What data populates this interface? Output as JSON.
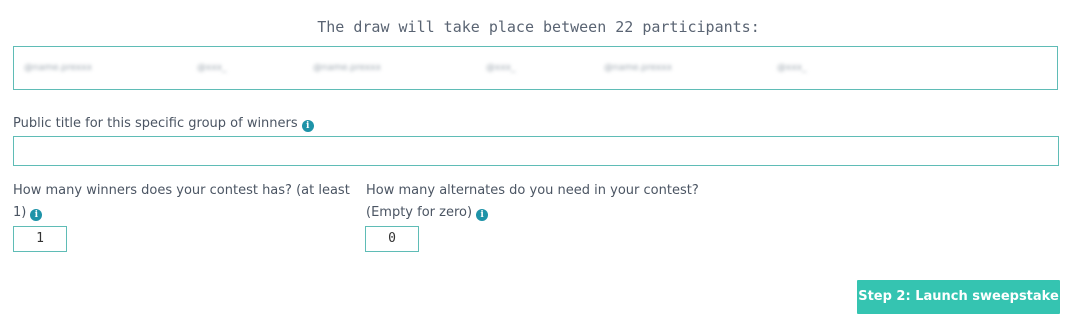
{
  "header": {
    "title": "The draw will take place between 22 participants:"
  },
  "participants": {
    "items": [
      "@name.prexxx",
      "@xxx_",
      "@name.prexxx",
      "@xxx_",
      "@name.prexxx",
      "@xxx_"
    ]
  },
  "form": {
    "public_title": {
      "label": "Public title for this specific group of winners",
      "value": ""
    },
    "winners": {
      "label_line1": "How many winners does your contest has? (at least",
      "label_line2": "1)",
      "value": "1"
    },
    "alternates": {
      "label_line1": "How many alternates do you need in your contest?",
      "label_line2": "(Empty for zero)",
      "value": "0"
    },
    "info_icon_glyph": "i",
    "submit_label": "Step 2: Launch sweepstake"
  },
  "colors": {
    "accent": "#35c4b1",
    "border": "#5fbcb6",
    "info": "#1e93a8"
  }
}
